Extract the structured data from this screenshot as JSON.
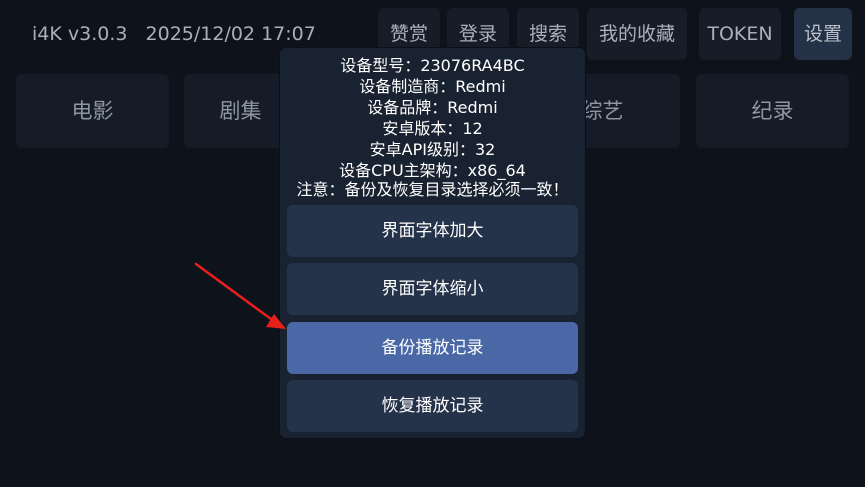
{
  "header": {
    "app_version": "i4K v3.0.3",
    "datetime": "2025/12/02 17:07"
  },
  "top_buttons": [
    {
      "label": "赞赏"
    },
    {
      "label": "登录"
    },
    {
      "label": "搜索"
    },
    {
      "label": "我的收藏"
    },
    {
      "label": "TOKEN"
    },
    {
      "label": "设置",
      "selected": true
    }
  ],
  "categories": [
    {
      "label": "电影"
    },
    {
      "label": "剧集"
    },
    {
      "label": "综艺"
    },
    {
      "label": "纪录"
    }
  ],
  "dialog": {
    "info": [
      "设备型号：23076RA4BC",
      "设备制造商：Redmi",
      "设备品牌：Redmi",
      "安卓版本：12",
      "安卓API级别：32",
      "设备CPU主架构：x86_64",
      "注意：备份及恢复目录选择必须一致！"
    ],
    "buttons": [
      {
        "label": "界面字体加大"
      },
      {
        "label": "界面字体缩小"
      },
      {
        "label": "备份播放记录",
        "focused": true
      },
      {
        "label": "恢复播放记录"
      }
    ]
  },
  "colors": {
    "background": "#0e131b",
    "dialog": "#192230",
    "button": "#24324a",
    "button_focused": "#4a67a6",
    "annotation_arrow": "#e8201c"
  },
  "icons": {
    "annotation": "red-arrow-icon"
  }
}
